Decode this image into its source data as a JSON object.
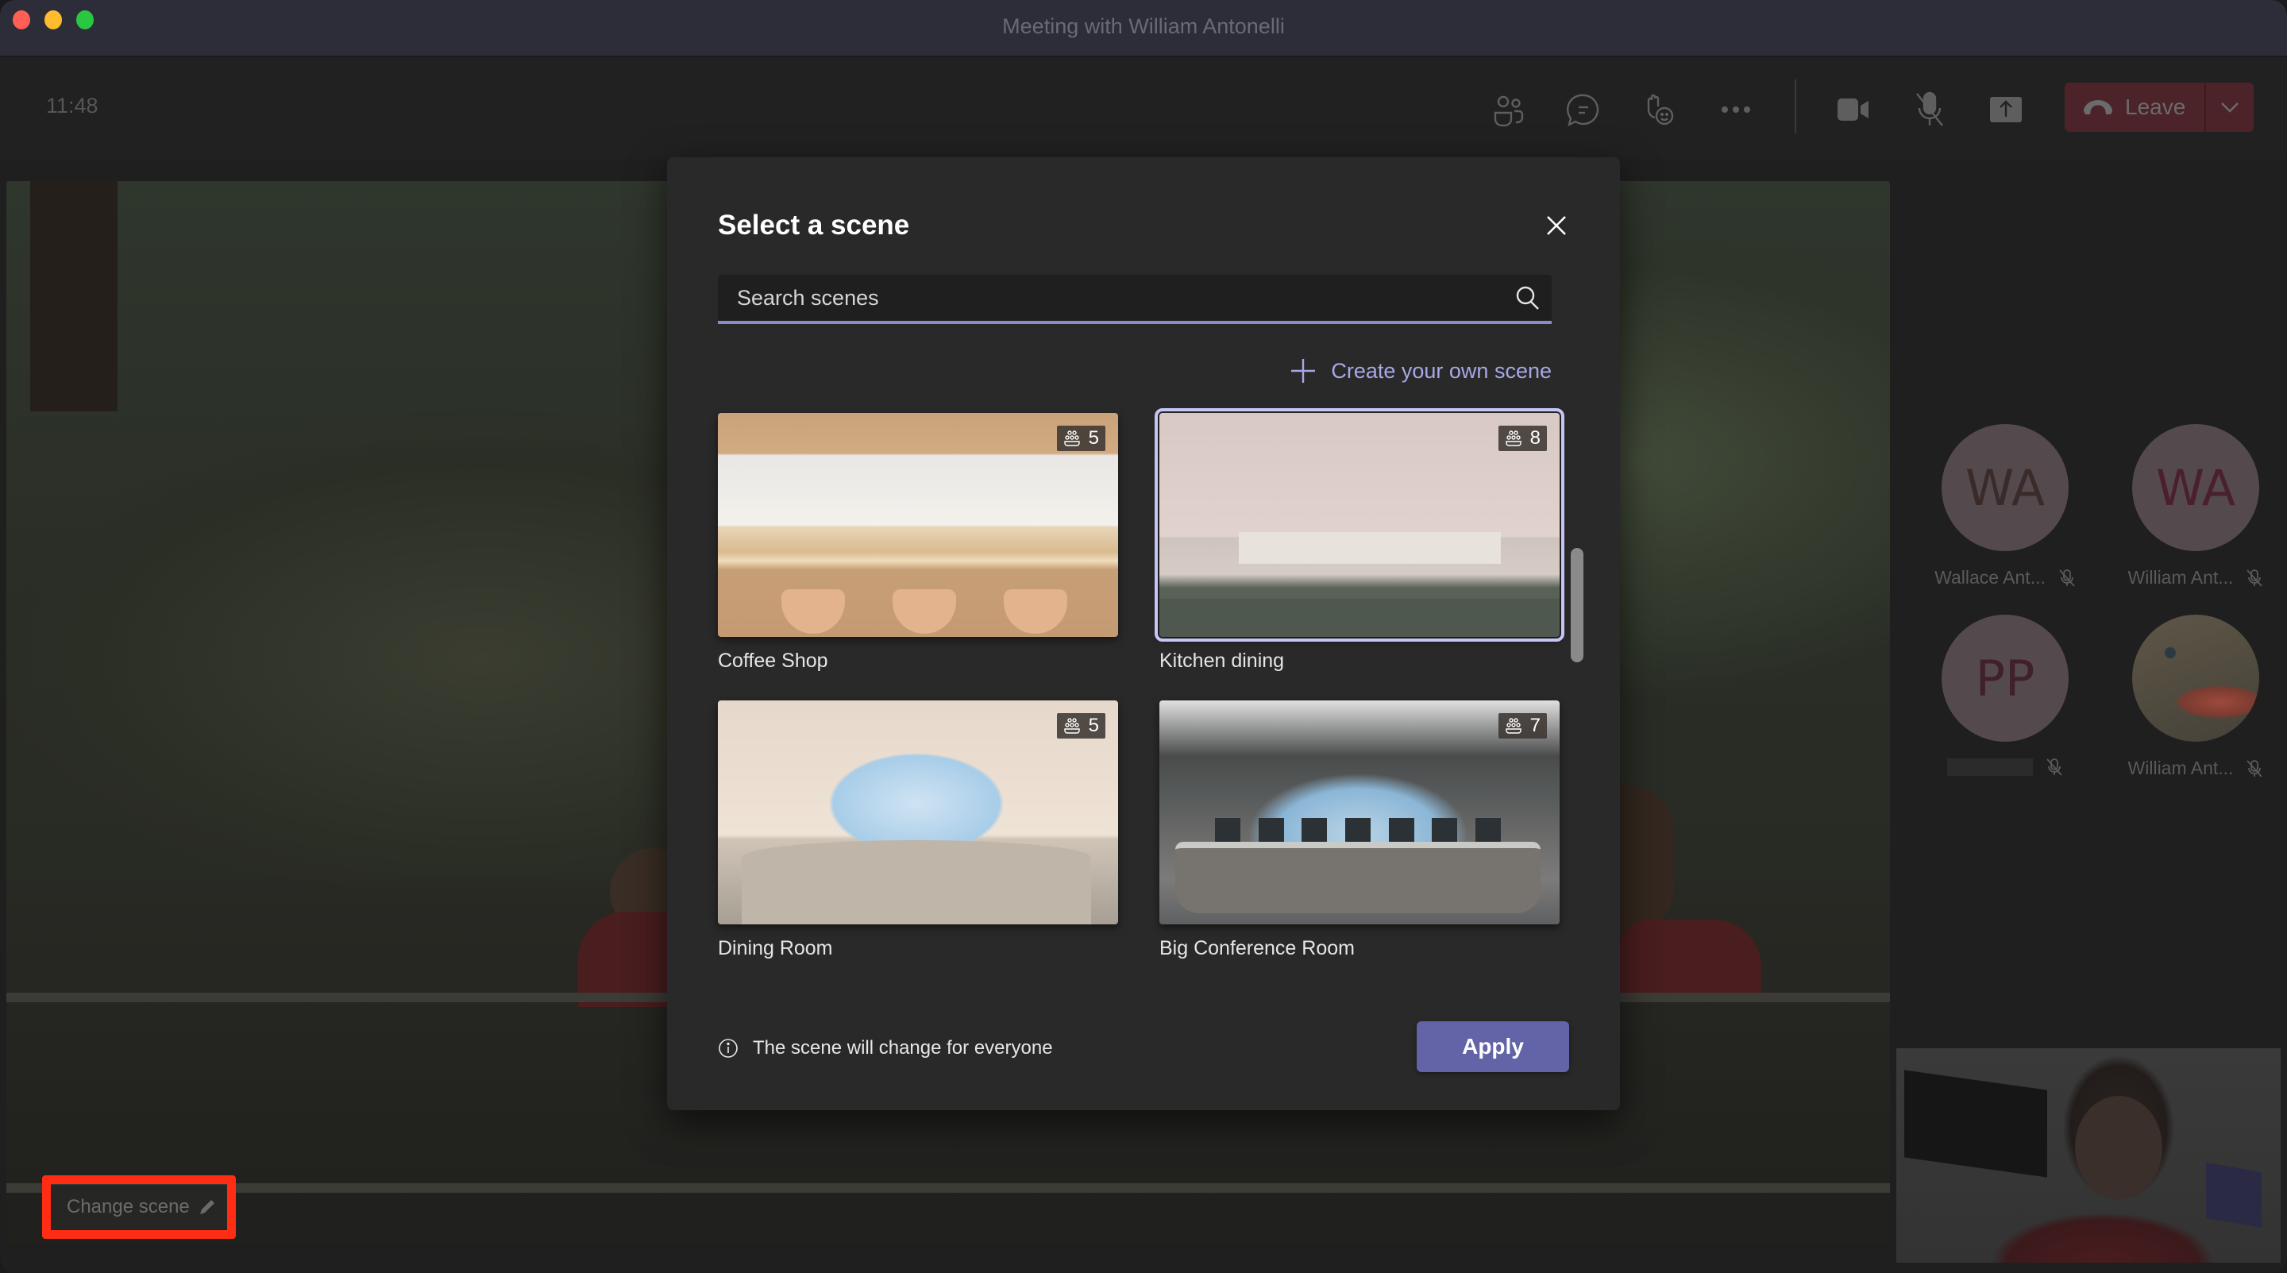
{
  "window": {
    "title": "Meeting with William Antonelli"
  },
  "toolbar": {
    "clock": "11:48",
    "buttons": [
      {
        "name": "people",
        "icon": "people-icon"
      },
      {
        "name": "chat",
        "icon": "chat-icon"
      },
      {
        "name": "reactions",
        "icon": "raise-hand-icon"
      },
      {
        "name": "more",
        "icon": "more-icon"
      },
      {
        "name": "camera",
        "icon": "camera-icon"
      },
      {
        "name": "mic",
        "icon": "mic-off-icon"
      },
      {
        "name": "share",
        "icon": "share-icon"
      }
    ],
    "leave_label": "Leave"
  },
  "stage": {
    "change_scene_label": "Change scene"
  },
  "participants": [
    {
      "initials": "WA",
      "name": "Wallace Ant...",
      "muted": true
    },
    {
      "initials": "WA",
      "name": "William Ant...",
      "muted": true
    },
    {
      "initials": "PP",
      "name": "",
      "name_redacted": true,
      "muted": true
    },
    {
      "initials": "",
      "name": "William Ant...",
      "has_photo": true,
      "muted": true
    }
  ],
  "dialog": {
    "title": "Select a scene",
    "search_placeholder": "Search scenes",
    "search_value": "",
    "create_label": "Create your own scene",
    "scenes": [
      {
        "name": "Coffee Shop",
        "capacity": "5",
        "selected": false
      },
      {
        "name": "Kitchen dining",
        "capacity": "8",
        "selected": true
      },
      {
        "name": "Dining Room",
        "capacity": "5",
        "selected": false
      },
      {
        "name": "Big Conference Room",
        "capacity": "7",
        "selected": false
      }
    ],
    "info_text": "The scene will change for everyone",
    "apply_label": "Apply"
  },
  "colors": {
    "accent": "#6264a7",
    "accent_light": "#a7a8e6",
    "leave_bg": "#4b2328",
    "highlight_annotation": "#ff2d14"
  }
}
